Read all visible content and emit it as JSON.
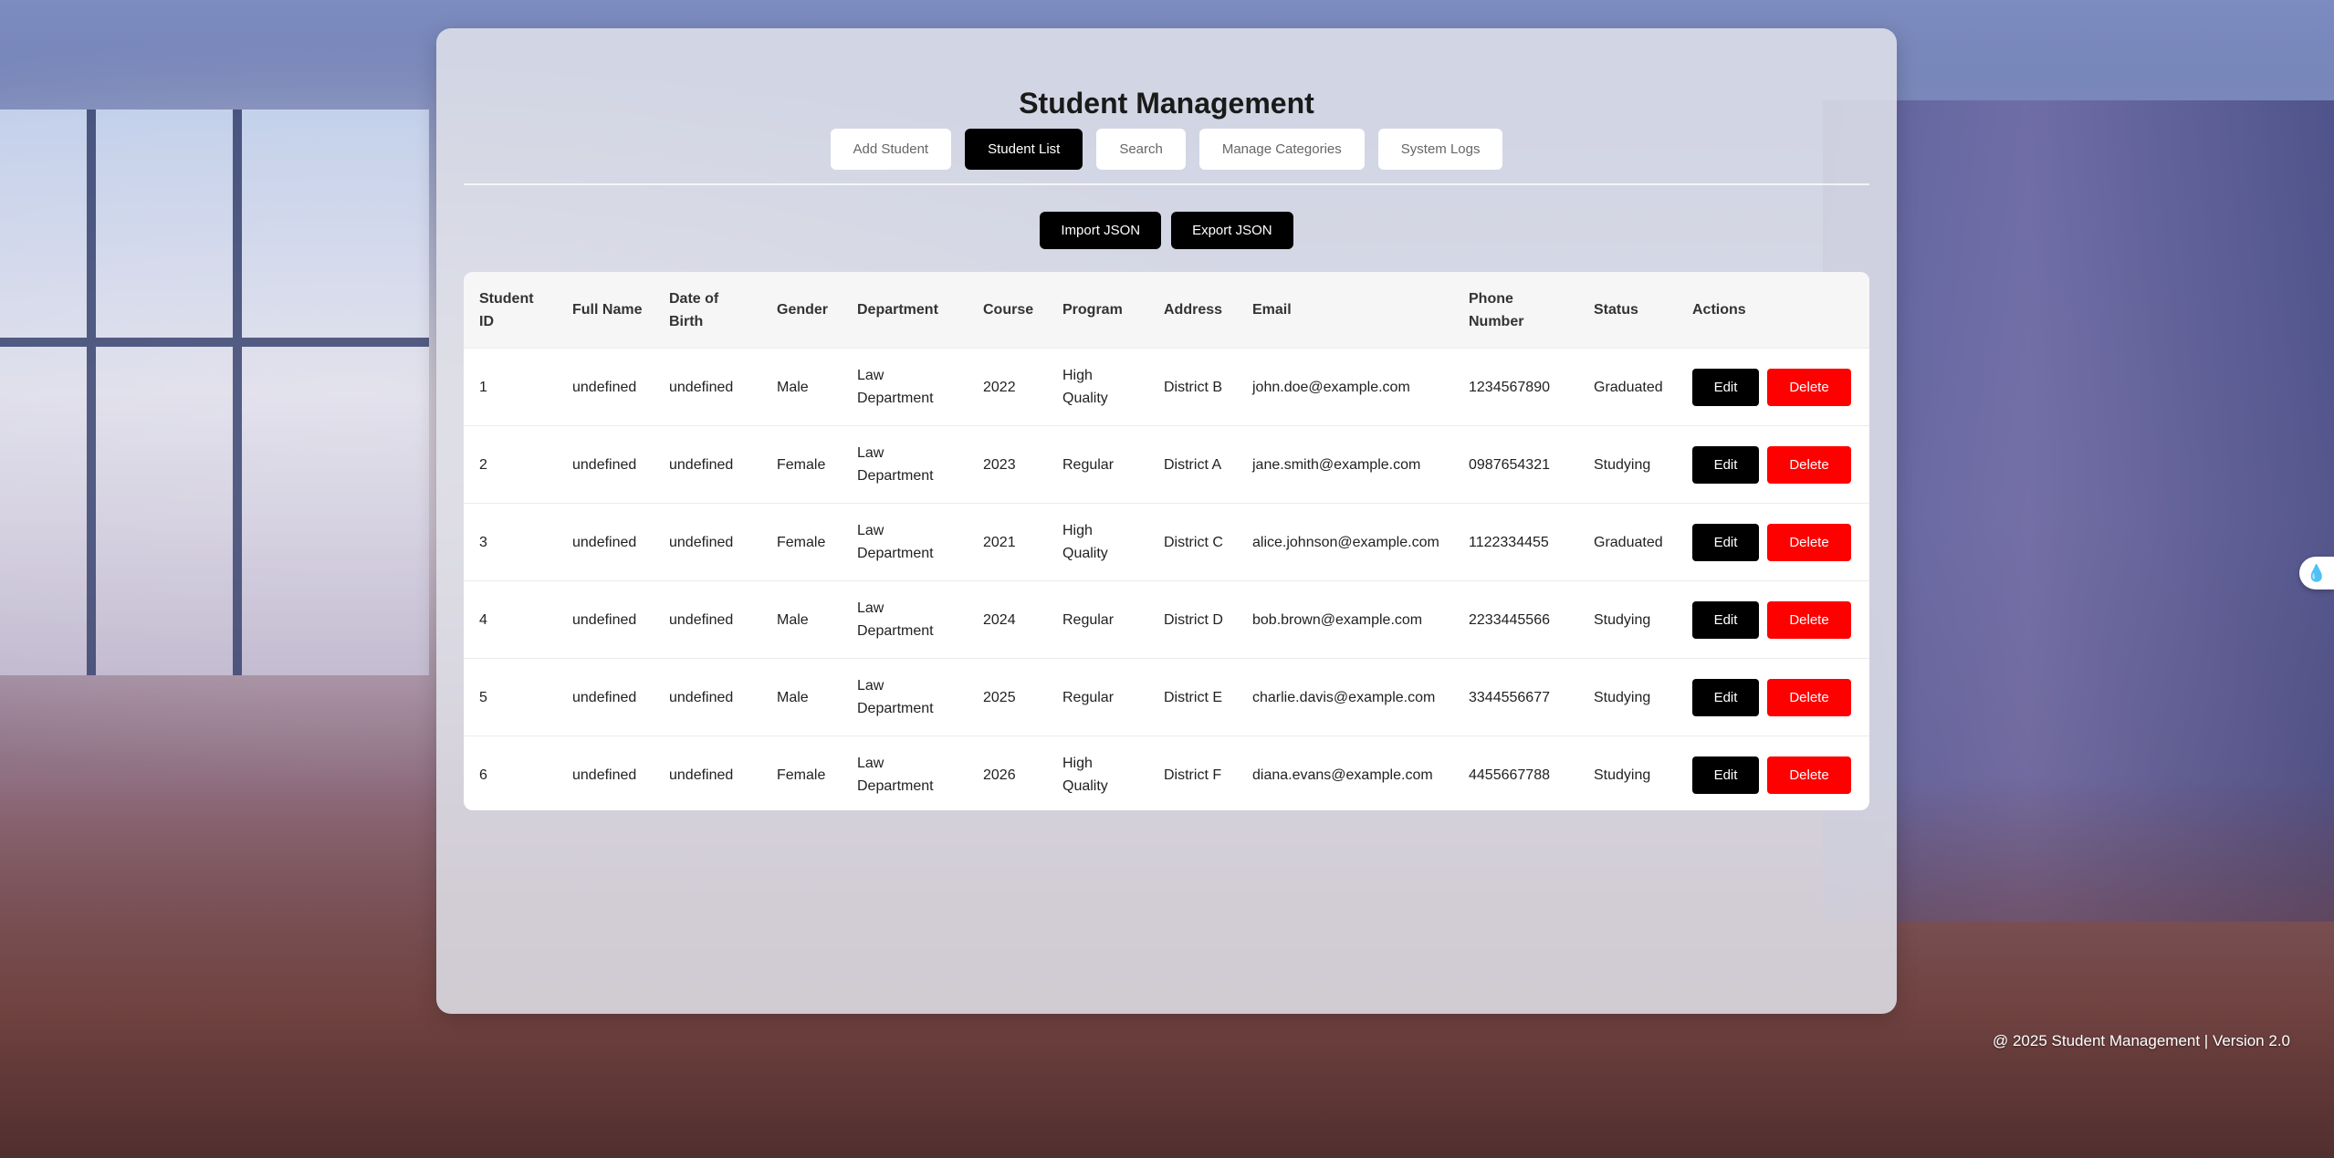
{
  "app": {
    "title": "Student Management"
  },
  "nav": {
    "tabs": [
      {
        "label": "Add Student",
        "active": false
      },
      {
        "label": "Student List",
        "active": true
      },
      {
        "label": "Search",
        "active": false
      },
      {
        "label": "Manage Categories",
        "active": false
      },
      {
        "label": "System Logs",
        "active": false
      }
    ]
  },
  "toolbar": {
    "import_label": "Import JSON",
    "export_label": "Export JSON"
  },
  "table": {
    "headers": {
      "student_id": "Student ID",
      "full_name": "Full Name",
      "date_of_birth": "Date of Birth",
      "gender": "Gender",
      "department": "Department",
      "course": "Course",
      "program": "Program",
      "address": "Address",
      "email": "Email",
      "phone": "Phone Number",
      "status": "Status",
      "actions": "Actions"
    },
    "edit_label": "Edit",
    "delete_label": "Delete",
    "rows": [
      {
        "id": "1",
        "name": "undefined",
        "dob": "undefined",
        "gender": "Male",
        "department": "Law Department",
        "course": "2022",
        "program": "High Quality",
        "address": "District B",
        "email": "john.doe@example.com",
        "phone": "1234567890",
        "status": "Graduated"
      },
      {
        "id": "2",
        "name": "undefined",
        "dob": "undefined",
        "gender": "Female",
        "department": "Law Department",
        "course": "2023",
        "program": "Regular",
        "address": "District A",
        "email": "jane.smith@example.com",
        "phone": "0987654321",
        "status": "Studying"
      },
      {
        "id": "3",
        "name": "undefined",
        "dob": "undefined",
        "gender": "Female",
        "department": "Law Department",
        "course": "2021",
        "program": "High Quality",
        "address": "District C",
        "email": "alice.johnson@example.com",
        "phone": "1122334455",
        "status": "Graduated"
      },
      {
        "id": "4",
        "name": "undefined",
        "dob": "undefined",
        "gender": "Male",
        "department": "Law Department",
        "course": "2024",
        "program": "Regular",
        "address": "District D",
        "email": "bob.brown@example.com",
        "phone": "2233445566",
        "status": "Studying"
      },
      {
        "id": "5",
        "name": "undefined",
        "dob": "undefined",
        "gender": "Male",
        "department": "Law Department",
        "course": "2025",
        "program": "Regular",
        "address": "District E",
        "email": "charlie.davis@example.com",
        "phone": "3344556677",
        "status": "Studying"
      },
      {
        "id": "6",
        "name": "undefined",
        "dob": "undefined",
        "gender": "Female",
        "department": "Law Department",
        "course": "2026",
        "program": "High Quality",
        "address": "District F",
        "email": "diana.evans@example.com",
        "phone": "4455667788",
        "status": "Studying"
      }
    ]
  },
  "footer": {
    "text": "@ 2025 Student Management | Version 2.0"
  },
  "widget": {
    "icon": "droplet-icon",
    "glyph": "💧"
  },
  "colors": {
    "primary": "#000000",
    "danger": "#ff0000",
    "panel": "#e1e2ea"
  }
}
